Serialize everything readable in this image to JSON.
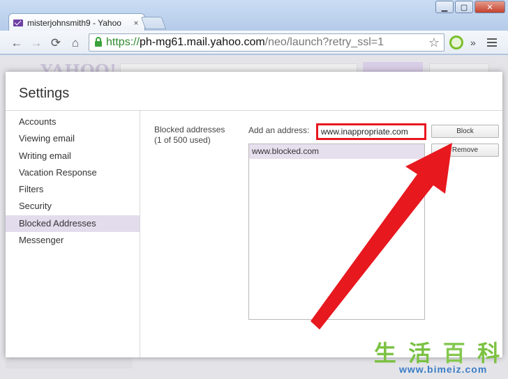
{
  "browser": {
    "tab_title": "misterjohnsmith9 - Yahoo",
    "tab_close": "×",
    "window_buttons": {
      "minimize": "▁",
      "maximize": "▢",
      "close": "✕"
    },
    "nav": {
      "back": "←",
      "forward": "→",
      "reload": "⟳",
      "home": "⌂"
    },
    "url": {
      "scheme": "https://",
      "host": "ph-mg61.mail.yahoo.com",
      "path": "/neo/launch?retry_ssl=1"
    },
    "bookmark_star": "☆",
    "overflow": "»"
  },
  "background_page": {
    "logo": "YAHOO!"
  },
  "settings": {
    "title": "Settings",
    "nav_items": [
      {
        "label": "Accounts"
      },
      {
        "label": "Viewing email"
      },
      {
        "label": "Writing email"
      },
      {
        "label": "Vacation Response"
      },
      {
        "label": "Filters"
      },
      {
        "label": "Security"
      },
      {
        "label": "Blocked Addresses",
        "active": true
      },
      {
        "label": "Messenger"
      }
    ],
    "blocked": {
      "section_label": "Blocked addresses",
      "usage": "(1 of 500 used)",
      "add_label": "Add an address:",
      "input_value": "www.inappropriate.com",
      "block_button": "Block",
      "remove_button": "Remove",
      "list": [
        "www.blocked.com"
      ]
    }
  },
  "annotation": {
    "arrow_color": "#e8181f",
    "highlight_color": "#e8181f"
  },
  "watermark": {
    "chars": [
      "生",
      "活",
      "百",
      "科"
    ],
    "url": "www.bimeiz.com"
  }
}
